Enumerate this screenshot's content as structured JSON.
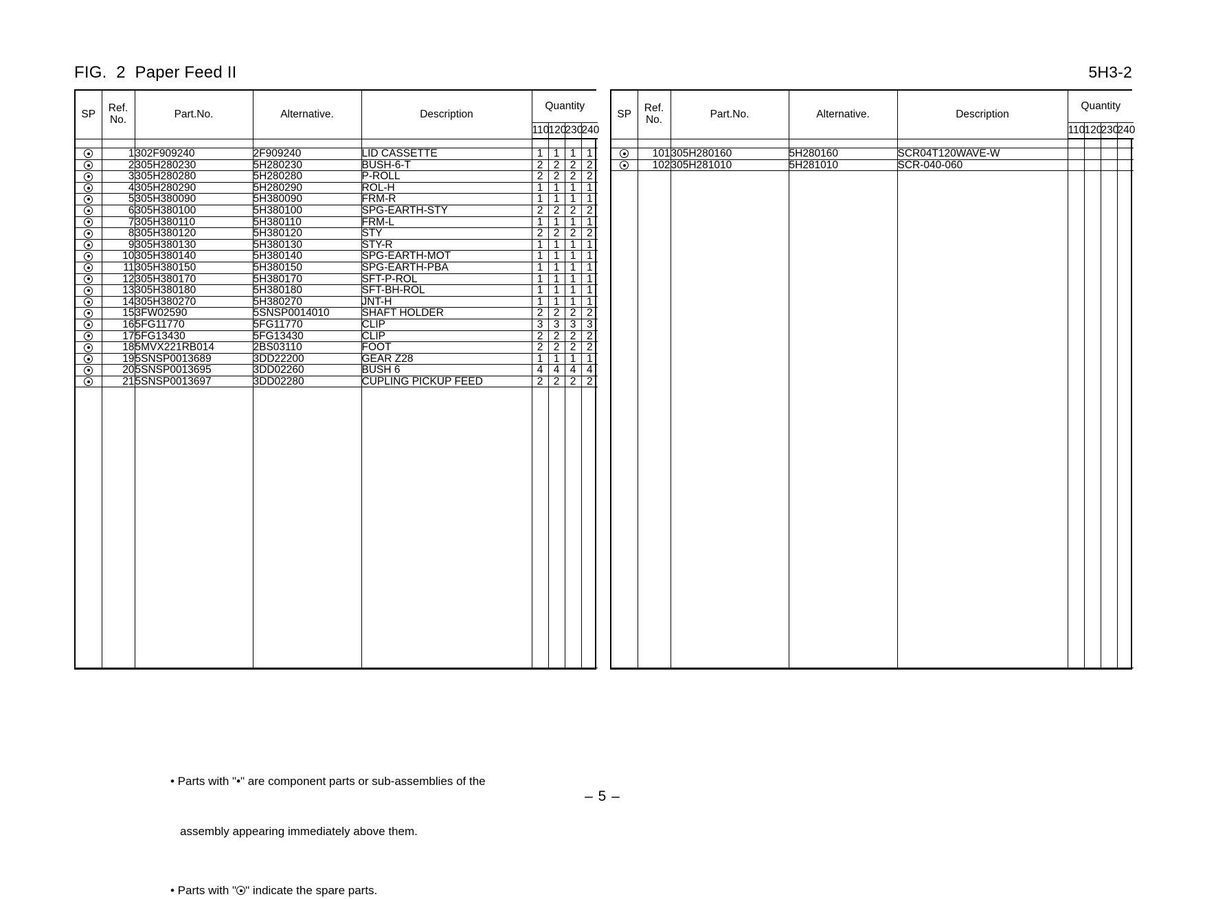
{
  "document": {
    "figure_title": "FIG.  2  Paper Feed II",
    "page_code": "5H3-2",
    "page_number": "– 5 –"
  },
  "table_headers": {
    "sp": "SP",
    "ref_no_line1": "Ref.",
    "ref_no_line2": "No.",
    "part_no": "Part.No.",
    "alternative": "Alternative.",
    "description": "Description",
    "quantity": "Quantity",
    "quantity_columns": [
      "110",
      "120",
      "230",
      "240"
    ]
  },
  "icons": {
    "spare_part": "circled-dot-icon",
    "bullet": "bullet-dot-icon"
  },
  "left_table": {
    "rows": [
      {
        "sp": "⊙",
        "ref": "1",
        "part": "302F909240",
        "alt": "2F909240",
        "desc": "LID CASSETTE",
        "q": [
          "1",
          "1",
          "1",
          "1"
        ]
      },
      {
        "sp": "⊙",
        "ref": "2",
        "part": "305H280230",
        "alt": "5H280230",
        "desc": "BUSH-6-T",
        "q": [
          "2",
          "2",
          "2",
          "2"
        ]
      },
      {
        "sp": "⊙",
        "ref": "3",
        "part": "305H280280",
        "alt": "5H280280",
        "desc": "P-ROLL",
        "q": [
          "2",
          "2",
          "2",
          "2"
        ]
      },
      {
        "sp": "⊙",
        "ref": "4",
        "part": "305H280290",
        "alt": "5H280290",
        "desc": "ROL-H",
        "q": [
          "1",
          "1",
          "1",
          "1"
        ]
      },
      {
        "sp": "⊙",
        "ref": "5",
        "part": "305H380090",
        "alt": "5H380090",
        "desc": "FRM-R",
        "q": [
          "1",
          "1",
          "1",
          "1"
        ]
      },
      {
        "sp": "⊙",
        "ref": "6",
        "part": "305H380100",
        "alt": "5H380100",
        "desc": "SPG-EARTH-STY",
        "q": [
          "2",
          "2",
          "2",
          "2"
        ]
      },
      {
        "sp": "⊙",
        "ref": "7",
        "part": "305H380110",
        "alt": "5H380110",
        "desc": "FRM-L",
        "q": [
          "1",
          "1",
          "1",
          "1"
        ]
      },
      {
        "sp": "⊙",
        "ref": "8",
        "part": "305H380120",
        "alt": "5H380120",
        "desc": "STY",
        "q": [
          "2",
          "2",
          "2",
          "2"
        ]
      },
      {
        "sp": "⊙",
        "ref": "9",
        "part": "305H380130",
        "alt": "5H380130",
        "desc": "STY-R",
        "q": [
          "1",
          "1",
          "1",
          "1"
        ]
      },
      {
        "sp": "⊙",
        "ref": "10",
        "part": "305H380140",
        "alt": "5H380140",
        "desc": "SPG-EARTH-MOT",
        "q": [
          "1",
          "1",
          "1",
          "1"
        ]
      },
      {
        "sp": "⊙",
        "ref": "11",
        "part": "305H380150",
        "alt": "5H380150",
        "desc": "SPG-EARTH-PBA",
        "q": [
          "1",
          "1",
          "1",
          "1"
        ]
      },
      {
        "sp": "⊙",
        "ref": "12",
        "part": "305H380170",
        "alt": "5H380170",
        "desc": "SFT-P-ROL",
        "q": [
          "1",
          "1",
          "1",
          "1"
        ]
      },
      {
        "sp": "⊙",
        "ref": "13",
        "part": "305H380180",
        "alt": "5H380180",
        "desc": "SFT-BH-ROL",
        "q": [
          "1",
          "1",
          "1",
          "1"
        ]
      },
      {
        "sp": "⊙",
        "ref": "14",
        "part": "305H380270",
        "alt": "5H380270",
        "desc": "JNT-H",
        "q": [
          "1",
          "1",
          "1",
          "1"
        ]
      },
      {
        "sp": "⊙",
        "ref": "15",
        "part": "3FW02590",
        "alt": "5SNSP0014010",
        "desc": "SHAFT HOLDER",
        "q": [
          "2",
          "2",
          "2",
          "2"
        ]
      },
      {
        "sp": "⊙",
        "ref": "16",
        "part": "5FG11770",
        "alt": "5FG11770",
        "desc": "CLIP",
        "q": [
          "3",
          "3",
          "3",
          "3"
        ]
      },
      {
        "sp": "⊙",
        "ref": "17",
        "part": "5FG13430",
        "alt": "5FG13430",
        "desc": "CLIP",
        "q": [
          "2",
          "2",
          "2",
          "2"
        ]
      },
      {
        "sp": "⊙",
        "ref": "18",
        "part": "5MVX221RB014",
        "alt": "2BS03110",
        "desc": "FOOT",
        "q": [
          "2",
          "2",
          "2",
          "2"
        ]
      },
      {
        "sp": "⊙",
        "ref": "19",
        "part": "5SNSP0013689",
        "alt": "3DD22200",
        "desc": "GEAR Z28",
        "q": [
          "1",
          "1",
          "1",
          "1"
        ]
      },
      {
        "sp": "⊙",
        "ref": "20",
        "part": "5SNSP0013695",
        "alt": "3DD02260",
        "desc": "BUSH 6",
        "q": [
          "4",
          "4",
          "4",
          "4"
        ]
      },
      {
        "sp": "⊙",
        "ref": "21",
        "part": "5SNSP0013697",
        "alt": "3DD02280",
        "desc": "CUPLING PICKUP FEED",
        "q": [
          "2",
          "2",
          "2",
          "2"
        ]
      }
    ]
  },
  "right_table": {
    "rows": [
      {
        "sp": "⊙",
        "ref": "101",
        "part": "305H280160",
        "alt": "5H280160",
        "desc": "SCR04T120WAVE-W",
        "q": [
          "",
          "",
          "",
          ""
        ]
      },
      {
        "sp": "⊙",
        "ref": "102",
        "part": "305H281010",
        "alt": "5H281010",
        "desc": "SCR-040-060",
        "q": [
          "",
          "",
          "",
          ""
        ]
      }
    ]
  },
  "footer": {
    "note1_line1": "• Parts with \"•\" are component parts or sub-assemblies of the",
    "note1_line2": "assembly appearing immediately above them.",
    "note2_prefix": "• Parts with \"",
    "note2_suffix": "\" indicate the spare parts."
  }
}
